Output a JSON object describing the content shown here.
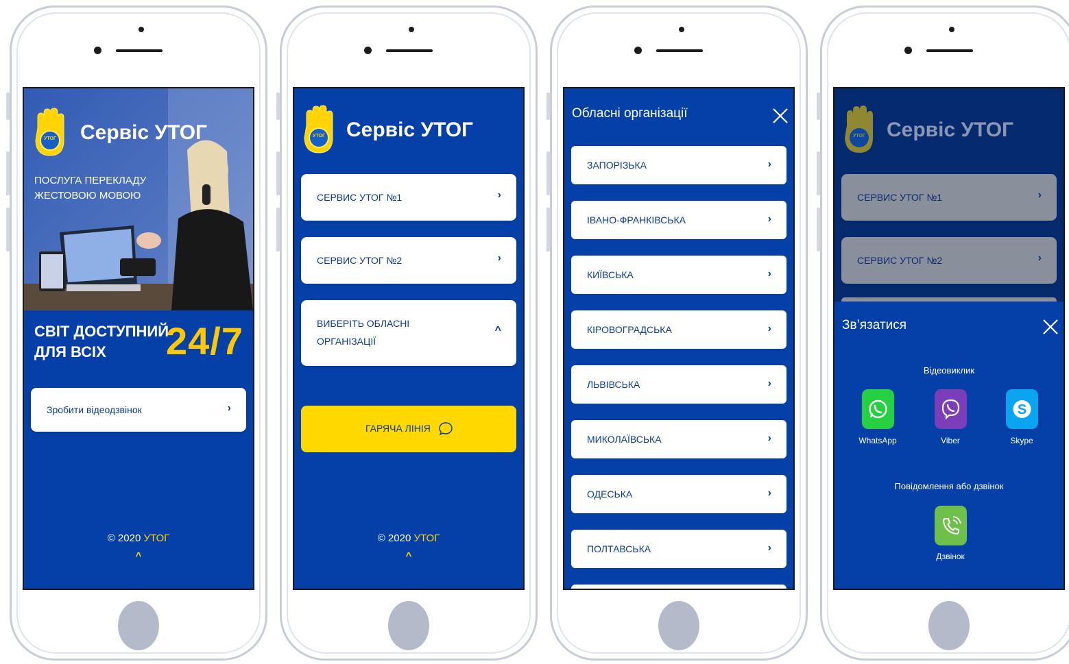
{
  "colors": {
    "screen_blue": "#0540a8",
    "accent_yellow": "#ffd400",
    "card_text": "#0a3a9c",
    "whatsapp_green": "#25d140",
    "viber_purple": "#7b3eb8",
    "skype_blue": "#0aa4f0",
    "call_green": "#6fbf4b"
  },
  "screen1": {
    "title": "Сервіс УТОГ",
    "logo_text": "УТОГ",
    "service_line1": "ПОСЛУГА ПЕРЕКЛАДУ",
    "service_line2": "ЖЕСТОВОЮ МОВОЮ",
    "slogan_line1": "СВІТ ДОСТУПНИЙ",
    "slogan_line2": "ДЛЯ ВСІХ",
    "slogan_big": "24/7",
    "video_call_button": "Зробити відеодзвінок",
    "footer_copy": "© 2020",
    "footer_brand": "УТОГ"
  },
  "screen2": {
    "title": "Сервіс УТОГ",
    "logo_text": "УТОГ",
    "menu": [
      {
        "label": "СЕРВИС УТОГ №1",
        "icon": "chevron-right-icon"
      },
      {
        "label": "СЕРВИС УТОГ №2",
        "icon": "chevron-right-icon"
      }
    ],
    "regional_line1": "ВИБЕРІТЬ ОБЛАСНІ",
    "regional_line2": "ОРГАНІЗАЦІЇ",
    "hotline_button": "ГАРЯЧА ЛІНІЯ",
    "footer_copy": "© 2020",
    "footer_brand": "УТОГ"
  },
  "screen3": {
    "title": "Обласні організації",
    "regions": [
      "ЗАПОРІЗЬКА",
      "ІВАНО-ФРАНКІВСЬКА",
      "КИЇВСЬКА",
      "КІРОВОГРАДСЬКА",
      "ЛЬВІВСЬКА",
      "МИКОЛАЇВСЬКА",
      "ОДЕСЬКА",
      "ПОЛТАВСЬКА"
    ]
  },
  "screen4": {
    "title": "Сервіс УТОГ",
    "logo_text": "УТОГ",
    "menu": [
      {
        "label": "СЕРВИС УТОГ №1"
      },
      {
        "label": "СЕРВИС УТОГ №2"
      }
    ],
    "sheet_title": "Зв’язатися",
    "video_section": "Відеовиклик",
    "apps": [
      {
        "label": "WhatsApp",
        "icon": "whatsapp-icon"
      },
      {
        "label": "Viber",
        "icon": "viber-icon"
      },
      {
        "label": "Skype",
        "icon": "skype-icon"
      }
    ],
    "message_section": "Повідомлення або дзвінок",
    "call_label": "Дзвінок"
  }
}
